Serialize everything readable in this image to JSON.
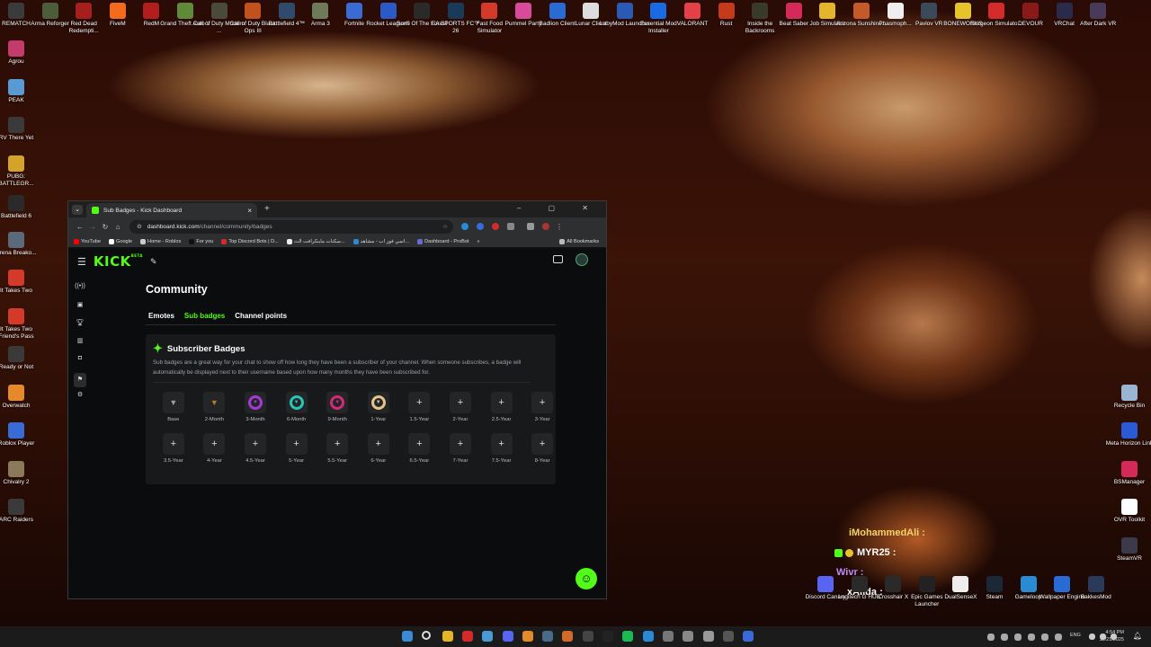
{
  "desktop_top": [
    {
      "label": "REMATCH",
      "color": "#3b3b3b"
    },
    {
      "label": "Arma Reforger",
      "color": "#4b5d3a"
    },
    {
      "label": "Red Dead Redempti...",
      "color": "#a61f1f"
    },
    {
      "label": "FiveM",
      "color": "#f26a1b"
    },
    {
      "label": "RedM",
      "color": "#b21d1d"
    },
    {
      "label": "Grand Theft Auto V",
      "color": "#5e8a3a"
    },
    {
      "label": "Call of Duty Modern ...",
      "color": "#4a4a3a"
    },
    {
      "label": "Call of Duty Black Ops III",
      "color": "#c1521e"
    },
    {
      "label": "Battlefield 4™",
      "color": "#2f4a6a"
    },
    {
      "label": "Arma 3",
      "color": "#6e7a5a"
    },
    {
      "label": "Fortnite",
      "color": "#3a6ad4"
    },
    {
      "label": "Rocket League®",
      "color": "#2b5ac7"
    },
    {
      "label": "Sons Of The Forest",
      "color": "#2a2a2a"
    },
    {
      "label": "EA SPORTS FC™ 26",
      "color": "#1a3a5a"
    },
    {
      "label": "Fast Food Simulator",
      "color": "#d43a2a"
    },
    {
      "label": "Pummel Party",
      "color": "#d84a9a"
    },
    {
      "label": "Badlion Client",
      "color": "#2a6ad4"
    },
    {
      "label": "Lunar Client",
      "color": "#dddddd"
    },
    {
      "label": "LabyMod Launcher",
      "color": "#2a5ab4"
    },
    {
      "label": "Essential Mod Installer",
      "color": "#1a6ae4"
    },
    {
      "label": "VALORANT",
      "color": "#e4404a"
    },
    {
      "label": "Rust",
      "color": "#c43a1a"
    },
    {
      "label": "Inside the Backrooms",
      "color": "#3a3a2a"
    },
    {
      "label": "Beat Saber",
      "color": "#d42a5a"
    },
    {
      "label": "Job Simulator",
      "color": "#e4b42a"
    },
    {
      "label": "Arizona Sunshine...",
      "color": "#c45a2a"
    },
    {
      "label": "Phasmoph...",
      "color": "#eeeeee"
    },
    {
      "label": "Pavlov VR",
      "color": "#3a4a5a"
    },
    {
      "label": "BONEWORKS",
      "color": "#e4c42a"
    },
    {
      "label": "Surgeon Simulato...",
      "color": "#d42a2a"
    },
    {
      "label": "DEVOUR",
      "color": "#8a1a1a"
    },
    {
      "label": "VRChat",
      "color": "#2a2a4a"
    },
    {
      "label": "After Dark VR",
      "color": "#4a3a5a"
    }
  ],
  "desktop_left": [
    {
      "label": "Agrou",
      "color": "#c43a6a"
    },
    {
      "label": "PEAK",
      "color": "#5a9ad4"
    },
    {
      "label": "RV There Yet",
      "color": "#3a3a3a"
    },
    {
      "label": "PUBG: BATTLEGR...",
      "color": "#d4a42a"
    },
    {
      "label": "Battlefield 6",
      "color": "#2a2a2a"
    },
    {
      "label": "Arena Breako...",
      "color": "#5a6a7a"
    },
    {
      "label": "It Takes Two",
      "color": "#d43a2a"
    },
    {
      "label": "It Takes Two Friend's Pass",
      "color": "#d43a2a"
    },
    {
      "label": "Ready or Not",
      "color": "#3a3a3a"
    },
    {
      "label": "Overwatch",
      "color": "#e48a2a"
    },
    {
      "label": "Roblox Player",
      "color": "#3a6ad4"
    },
    {
      "label": "Chivalry 2",
      "color": "#8a7a5a"
    },
    {
      "label": "ARC Raiders",
      "color": "#3a3a3a"
    }
  ],
  "desktop_right": [
    {
      "label": "Recycle Bin",
      "color": "#9ab4d4"
    },
    {
      "label": "Meta Horizon Link",
      "color": "#2a5ad4"
    },
    {
      "label": "BSManager",
      "color": "#d42a5a"
    },
    {
      "label": "OVR Toolkit",
      "color": "#ffffff"
    },
    {
      "label": "SteamVR",
      "color": "#3a3a4a"
    }
  ],
  "desktop_bottom": [
    {
      "label": "Discord Canary",
      "color": "#5865f2"
    },
    {
      "label": "Logitech G HUB",
      "color": "#2a2a2a"
    },
    {
      "label": "Crosshair X",
      "color": "#2a2a2a"
    },
    {
      "label": "Epic Games Launcher",
      "color": "#222222"
    },
    {
      "label": "DualSenseX",
      "color": "#eeeeee"
    },
    {
      "label": "Steam",
      "color": "#1b2838"
    },
    {
      "label": "Gameloop",
      "color": "#2a8ad4"
    },
    {
      "label": "Wallpaper Engine",
      "color": "#2a6ad4"
    },
    {
      "label": "BakkesMod",
      "color": "#2a3a5a"
    }
  ],
  "browser": {
    "tab_title": "Sub Badges - Kick Dashboard",
    "tab_close": "×",
    "new_tab": "+",
    "window_controls": "– ▢ ✕",
    "url_host": "dashboard.kick.com",
    "url_path": "/channel/community/badges",
    "bookmarks": [
      {
        "label": "YouTube",
        "color": "#ff0000"
      },
      {
        "label": "Google",
        "color": "#ffffff"
      },
      {
        "label": "Home - Roblox",
        "color": "#cccccc"
      },
      {
        "label": "For you",
        "color": "#111111"
      },
      {
        "label": "Top Discord Bots | D...",
        "color": "#d42a2a"
      },
      {
        "label": "سكنات ماينكرافت الث...",
        "color": "#eeeeee"
      },
      {
        "label": "انمي فور اب - مشاهد...",
        "color": "#2a8ad4"
      },
      {
        "label": "Dashboard - ProBot",
        "color": "#6a6ad4"
      }
    ],
    "all_bookmarks": "All Bookmarks"
  },
  "kick": {
    "logo": "KICK",
    "beta": "BETA",
    "page_title": "Community",
    "tabs": [
      "Emotes",
      "Sub badges",
      "Channel points"
    ],
    "active_tab": "Sub badges",
    "card_title": "Subscriber Badges",
    "card_desc": "Sub badges are a great way for your chat to show off how long they have been a subscriber of your channel. When someone subscribes, a badge will automatically be displayed next to their username based upon how many months they have been subscribed for.",
    "badges": [
      {
        "label": "Base",
        "kind": "set",
        "color": "#9e9e9e"
      },
      {
        "label": "2-Month",
        "kind": "set",
        "color": "#b87a2a"
      },
      {
        "label": "3-Month",
        "kind": "set",
        "color": "#a23ad4"
      },
      {
        "label": "6-Month",
        "kind": "set",
        "color": "#2ac4b4"
      },
      {
        "label": "9-Month",
        "kind": "set",
        "color": "#d42a7a"
      },
      {
        "label": "1-Year",
        "kind": "set",
        "color": "#e4c48a"
      },
      {
        "label": "1.5-Year",
        "kind": "empty"
      },
      {
        "label": "2-Year",
        "kind": "empty"
      },
      {
        "label": "2.5-Year",
        "kind": "empty"
      },
      {
        "label": "3-Year",
        "kind": "empty"
      },
      {
        "label": "3.5-Year",
        "kind": "empty"
      },
      {
        "label": "4-Year",
        "kind": "empty"
      },
      {
        "label": "4.5-Year",
        "kind": "empty"
      },
      {
        "label": "5-Year",
        "kind": "empty"
      },
      {
        "label": "5.5-Year",
        "kind": "empty"
      },
      {
        "label": "6-Year",
        "kind": "empty"
      },
      {
        "label": "6.5-Year",
        "kind": "empty"
      },
      {
        "label": "7-Year",
        "kind": "empty"
      },
      {
        "label": "7.5-Year",
        "kind": "empty"
      },
      {
        "label": "8-Year",
        "kind": "empty"
      }
    ]
  },
  "overlay": {
    "line1": "iMohammedAli :",
    "line2": "MYR25 :",
    "line3": "Wivr :",
    "line4": "xAilda :"
  },
  "tray": {
    "lang": "ENG",
    "time": "4:54 PM",
    "date": "12/21/2025"
  },
  "taskbar_apps": [
    {
      "name": "start",
      "color": "#3a8ad4"
    },
    {
      "name": "search",
      "color": "#dddddd"
    },
    {
      "name": "file-explorer",
      "color": "#e4b42a"
    },
    {
      "name": "app-red",
      "color": "#d42a2a"
    },
    {
      "name": "chrome",
      "color": "#4a9ad4"
    },
    {
      "name": "discord",
      "color": "#5865f2"
    },
    {
      "name": "app-orange",
      "color": "#e48a2a"
    },
    {
      "name": "steam",
      "color": "#4a6a8a"
    },
    {
      "name": "app-orange-2",
      "color": "#d46a2a"
    },
    {
      "name": "app-dark",
      "color": "#444444"
    },
    {
      "name": "app-black",
      "color": "#222222"
    },
    {
      "name": "spotify",
      "color": "#1db954"
    },
    {
      "name": "app-blue",
      "color": "#2a8ad4"
    },
    {
      "name": "xbox",
      "color": "#777777"
    },
    {
      "name": "app-grey",
      "color": "#888888"
    },
    {
      "name": "app-grey-2",
      "color": "#999999"
    },
    {
      "name": "app-dark-2",
      "color": "#555555"
    },
    {
      "name": "app-blue-2",
      "color": "#3a6ad4"
    }
  ]
}
